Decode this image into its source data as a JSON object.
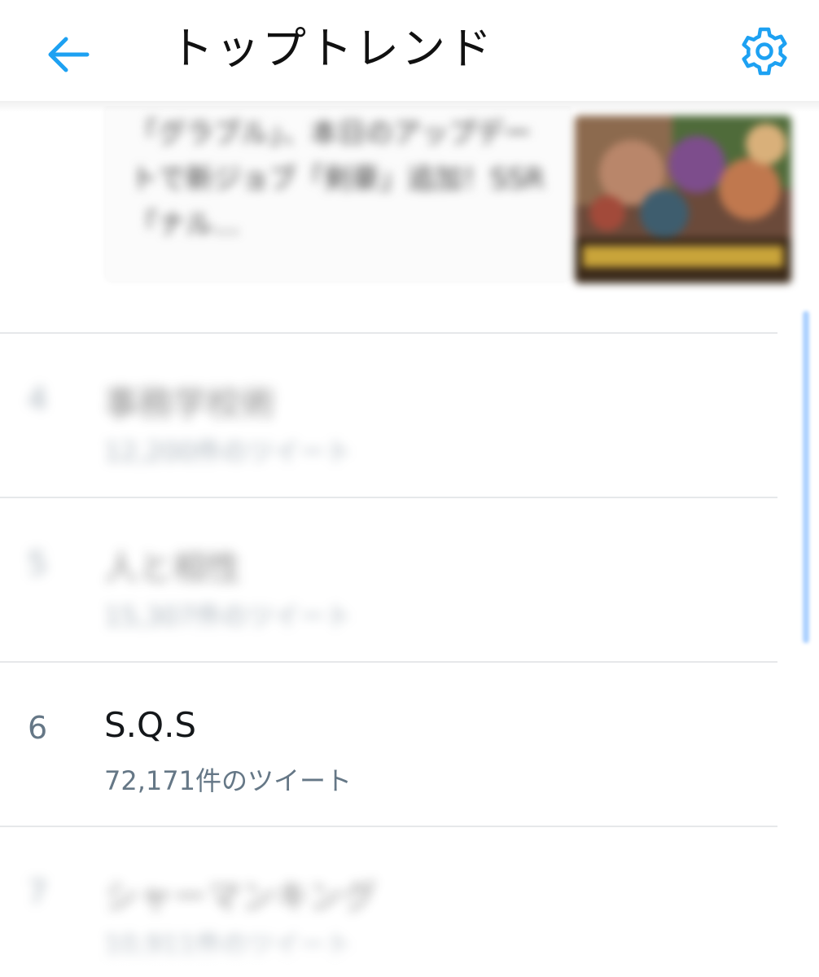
{
  "header": {
    "title": "トップトレンド",
    "back_icon": "arrow-left-icon",
    "settings_icon": "gear-icon",
    "accent_color": "#1da1f2"
  },
  "news_card": {
    "text": "「グラブル」、本日のアップデートで新ジョブ「剣豪」追加！SSR「ナル..."
  },
  "trends": [
    {
      "rank": "4",
      "name": "事務学校術",
      "count": "12,200件のツイート",
      "blurred": true
    },
    {
      "rank": "5",
      "name": "人と相性",
      "count": "15,307件のツイート",
      "blurred": true
    },
    {
      "rank": "6",
      "name": "S.Q.S",
      "count": "72,171件のツイート",
      "blurred": false
    },
    {
      "rank": "7",
      "name": "シャーマンキング",
      "count": "10,911件のツイート",
      "blurred": true
    }
  ]
}
